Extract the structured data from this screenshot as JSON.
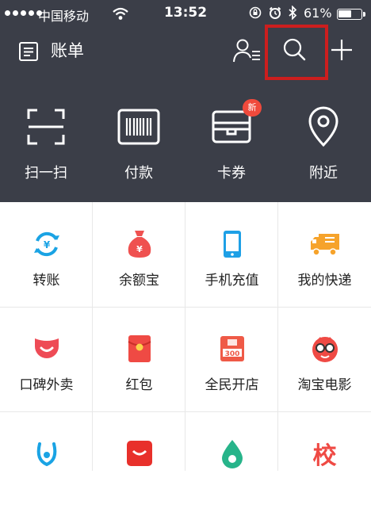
{
  "status_bar": {
    "carrier": "中国移动",
    "time": "13:52",
    "battery": "61%",
    "battery_level": 0.61
  },
  "header": {
    "bill_label": "账单"
  },
  "quick_actions": [
    {
      "label": "扫一扫",
      "icon": "scan-icon"
    },
    {
      "label": "付款",
      "icon": "barcode-icon"
    },
    {
      "label": "卡券",
      "icon": "wallet-icon",
      "badge": "新"
    },
    {
      "label": "附近",
      "icon": "location-pin-icon"
    }
  ],
  "grid": {
    "rows": [
      [
        {
          "label": "转账",
          "icon": "transfer-icon"
        },
        {
          "label": "余额宝",
          "icon": "money-bag-icon"
        },
        {
          "label": "手机充值",
          "icon": "phone-icon"
        },
        {
          "label": "我的快递",
          "icon": "truck-icon"
        }
      ],
      [
        {
          "label": "口碑外卖",
          "icon": "koubei-icon"
        },
        {
          "label": "红包",
          "icon": "red-envelope-icon"
        },
        {
          "label": "全民开店",
          "icon": "shop-icon"
        },
        {
          "label": "淘宝电影",
          "icon": "movie-icon"
        }
      ],
      [
        {
          "label": "",
          "icon": "smile-icon"
        },
        {
          "label": "",
          "icon": "tmall-icon"
        },
        {
          "label": "",
          "icon": "drop-icon"
        },
        {
          "label": "校",
          "icon": "campus-icon"
        }
      ]
    ]
  },
  "colors": {
    "header_bg": "#3b3e48",
    "highlight": "#cc1e1e",
    "badge": "#f04a3c"
  }
}
